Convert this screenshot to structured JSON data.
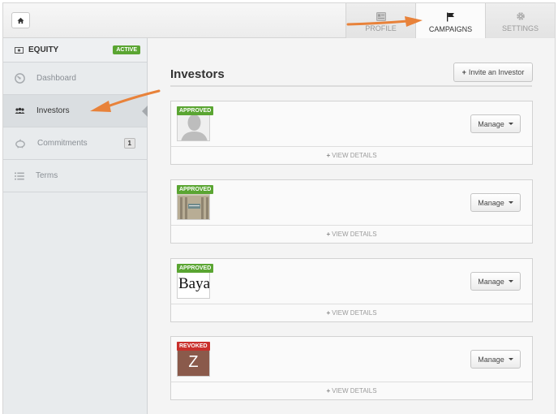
{
  "topbar": {
    "tabs": [
      {
        "label": "PROFILE",
        "icon": "profile-icon",
        "active": false
      },
      {
        "label": "CAMPAIGNS",
        "icon": "flag-icon",
        "active": true
      },
      {
        "label": "SETTINGS",
        "icon": "gear-icon",
        "active": false
      }
    ]
  },
  "sidebar": {
    "header": {
      "title": "EQUITY",
      "badge": "ACTIVE"
    },
    "items": [
      {
        "label": "Dashboard",
        "icon": "dashboard-icon"
      },
      {
        "label": "Investors",
        "icon": "people-icon",
        "active": true
      },
      {
        "label": "Commitments",
        "icon": "piggy-bank-icon",
        "count": "1"
      },
      {
        "label": "Terms",
        "icon": "list-icon"
      }
    ]
  },
  "main": {
    "title": "Investors",
    "invite_label": "Invite an Investor",
    "cards": [
      {
        "status": "APPROVED",
        "manage_label": "Manage",
        "details_label": "VIEW DETAILS"
      },
      {
        "status": "APPROVED",
        "manage_label": "Manage",
        "details_label": "VIEW DETAILS"
      },
      {
        "status": "APPROVED",
        "manage_label": "Manage",
        "details_label": "VIEW DETAILS",
        "avatar_text": "Baya"
      },
      {
        "status": "REVOKED",
        "manage_label": "Manage",
        "details_label": "VIEW DETAILS",
        "avatar_text": "Z"
      }
    ]
  },
  "colors": {
    "approved": "#5aa532",
    "revoked": "#c9302c",
    "annotation_arrow": "#e8823a"
  }
}
